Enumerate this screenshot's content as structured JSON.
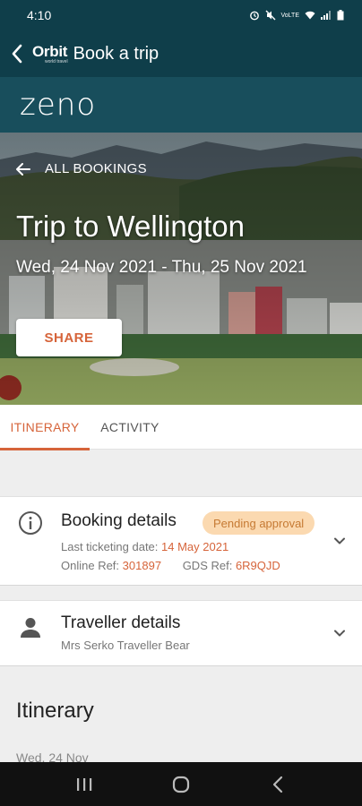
{
  "status_bar": {
    "time": "4:10",
    "network": "VoLTE"
  },
  "app_bar": {
    "logo_text": "Orbit",
    "logo_tagline": "world travel",
    "title": "Book a trip"
  },
  "brand": {
    "logo_text": "zeno"
  },
  "hero": {
    "back_label": "ALL BOOKINGS",
    "trip_title": "Trip to Wellington",
    "dates": "Wed, 24 Nov 2021 - Thu, 25 Nov 2021",
    "share_label": "SHARE"
  },
  "tabs": [
    {
      "label": "ITINERARY",
      "active": true
    },
    {
      "label": "ACTIVITY",
      "active": false
    }
  ],
  "booking_details": {
    "title": "Booking details",
    "status": "Pending approval",
    "ticketing_label": "Last ticketing date:",
    "ticketing_date": "14 May 2021",
    "online_ref_label": "Online Ref:",
    "online_ref": "301897",
    "gds_ref_label": "GDS Ref:",
    "gds_ref": "6R9QJD",
    "icon": "info-icon"
  },
  "traveller_details": {
    "title": "Traveller details",
    "name": "Mrs Serko Traveller Bear",
    "icon": "person-icon"
  },
  "itinerary": {
    "heading": "Itinerary",
    "day_label": "Wed, 24 Nov"
  },
  "colors": {
    "accent": "#d6643a",
    "header": "#0f3e4a",
    "brand_bar": "#184e5c",
    "badge_bg": "#fbd9b0"
  }
}
